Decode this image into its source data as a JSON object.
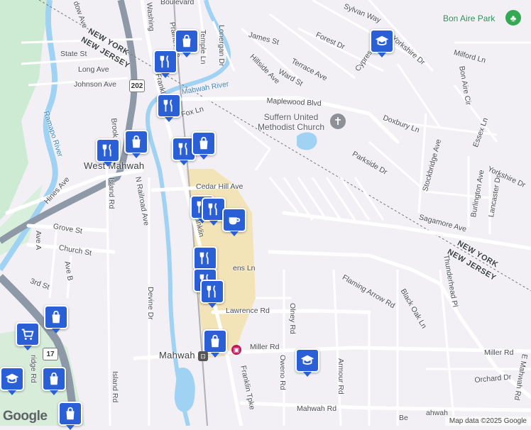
{
  "map": {
    "places": {
      "west_mahwah": "West Mahwah",
      "mahwah": "Mahwah",
      "bon_aire_park": "Bon Aire Park",
      "church": "Suffern United Methodist Church"
    },
    "state_lines": [
      {
        "ny": "NEW YORK",
        "nj": "NEW JERSEY"
      },
      {
        "ny": "NEW YORK",
        "nj": "NEW JERSEY"
      }
    ],
    "water": {
      "ramapo_river": "Ramapo River",
      "mahwah_river": "Mahwah River"
    },
    "shields": {
      "us202": "202",
      "nj17": "17"
    },
    "streets": {
      "boulevard": "Boulevard",
      "meadow_ave": "dow Ave",
      "washington": "Washing",
      "prairie_ave": "Prairie Ave",
      "temple_ln": "Temple Ln",
      "lonergan_dr": "Lonergan Dr",
      "state_st": "State St",
      "long_ave": "Long Ave",
      "johnson_ave": "Johnson Ave",
      "franklin_tpke_n": "Franklin Tpke",
      "fox_ln": "Fox Ln",
      "brook": "Brook",
      "island_rd": "Island Rd",
      "n_railroad_ave": "N Railroad Ave",
      "hines_ave": "Hines Ave",
      "cedar_hill_ave": "Cedar Hill Ave",
      "grove_st": "Grove St",
      "church_st": "Church St",
      "ave_a": "Ave A",
      "ave_b": "Ave B",
      "third_st": "3rd St",
      "devine_dr": "Devine Dr",
      "franklin_short": "Franklin",
      "stephens_ln": "ens Ln",
      "lawrence_rd": "Lawrence Rd",
      "olney_rd": "Olney Rd",
      "miller_rd": "Miller Rd",
      "miller_rd_2": "Miller Rd",
      "oweno_rd": "Oweno Rd",
      "armour_rd": "Armour Rd",
      "mahwah_rd": "Mahwah Rd",
      "franklin_tpke_s": "Franklin Tpke",
      "island_rd_s": "Island Rd",
      "bridge_rd": "ridge Rd",
      "james_st": "James St",
      "forest_dr": "Forest Dr",
      "hillside_ave": "Hillside Ave",
      "terrace_ave": "Terrace Ave",
      "ward_st": "Ward St",
      "sylvan_way": "Sylvan Way",
      "cypress": "Cypress",
      "yorkshire_dr": "Yorkshire Dr",
      "yorkshire_dr_2": "Yorkshire Dr",
      "milford_ln": "Milford Ln",
      "bon_aire_cir": "Bon Aire Cir",
      "maplewood_blvd": "Maplewood Blvd",
      "doxbury_ln": "Doxbury Ln",
      "parkside_dr": "Parkside Dr",
      "stockbridge_ave": "Stockbridge Ave",
      "essex_ln": "Essex Ln",
      "burlington_ave": "Burlington Ave",
      "lancaster_dr": "Lancaster Dr",
      "sagamore_ave": "Sagamore Ave",
      "flaming_arrow_rd": "Flaming Arrow Rd",
      "black_oak_ln": "Black Oak Ln",
      "thunderhead_pl": "Thunderhead Pl",
      "orchard_dr": "Orchard Dr",
      "e_mahwah_rd": "E Mahwah Rd",
      "be": "Be",
      "ahwah": "ahwah"
    },
    "footer": {
      "logo": "Google",
      "attribution": "Map data ©2025 Google"
    },
    "colors": {
      "road": "#ffffff",
      "road_edge": "#d9d6de",
      "background": "#f2f0f4",
      "park": "#cdebd3",
      "water": "#9fd2f3",
      "commercial": "#f3e4b8",
      "highway": "#8e99a8",
      "pin": "#2b5fd6"
    },
    "pins": [
      {
        "name": "restaurant",
        "icon": "fork-knife-icon"
      },
      {
        "name": "shopping",
        "icon": "shopping-bag-icon"
      },
      {
        "name": "school",
        "icon": "mortarboard-icon"
      },
      {
        "name": "cafe",
        "icon": "coffee-cup-icon"
      },
      {
        "name": "grocery",
        "icon": "shopping-cart-icon"
      }
    ]
  }
}
